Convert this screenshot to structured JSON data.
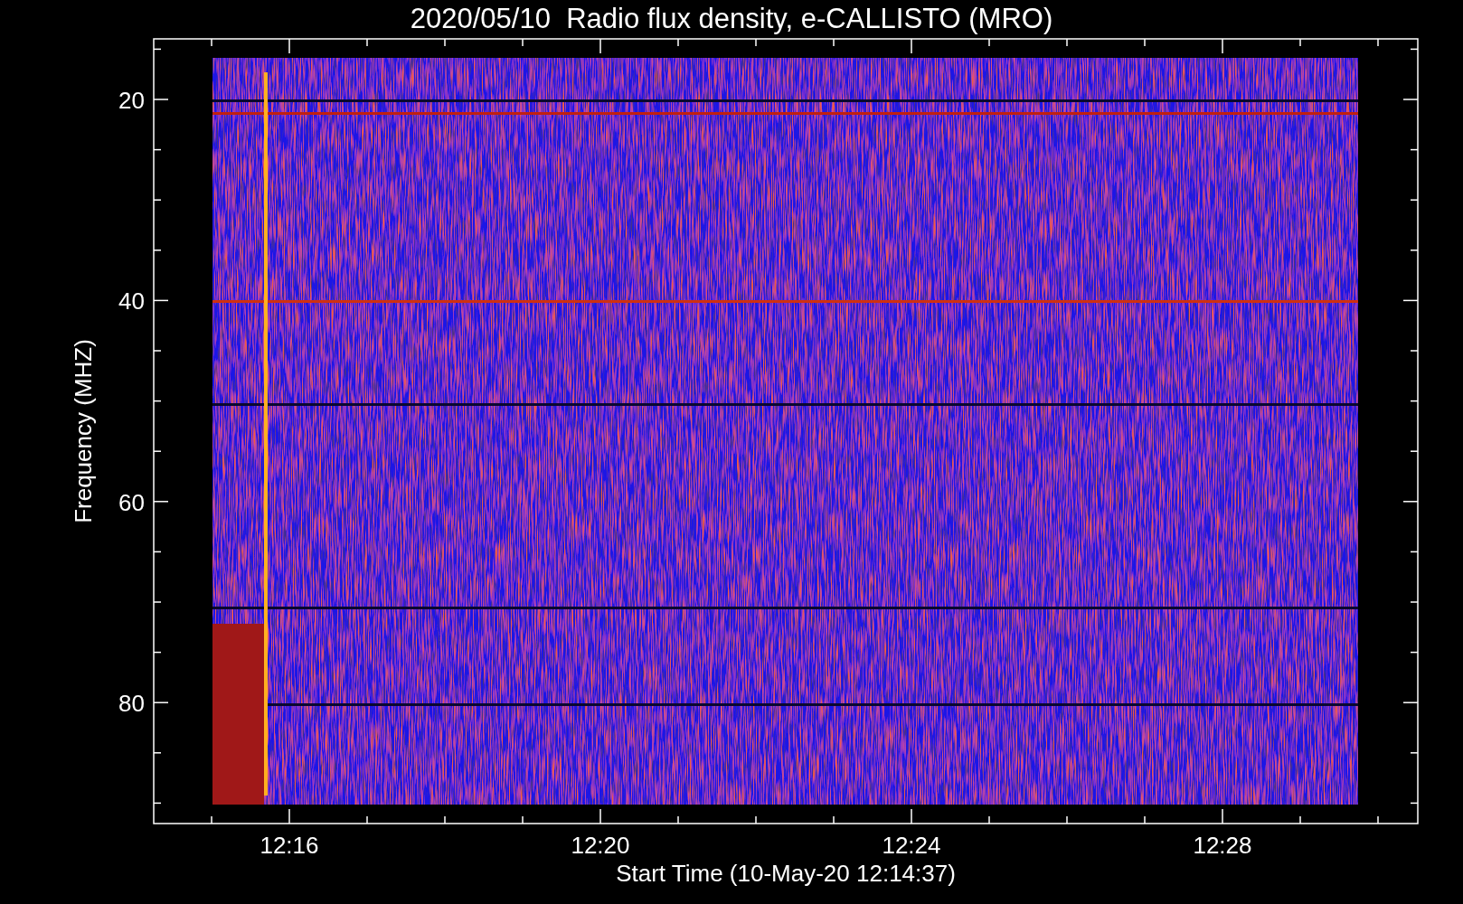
{
  "title": "2020/05/10  Radio flux density, e-CALLISTO (MRO)",
  "plot": {
    "xlabel": "Start Time (10-May-20 12:14:37)",
    "ylabel": "Frequency (MHZ)",
    "xticks": [
      {
        "label": "12:16"
      },
      {
        "label": "12:20"
      },
      {
        "label": "12:24"
      },
      {
        "label": "12:28"
      }
    ],
    "yticks": [
      {
        "label": "20"
      },
      {
        "label": "40"
      },
      {
        "label": "60"
      },
      {
        "label": "80"
      }
    ]
  }
}
